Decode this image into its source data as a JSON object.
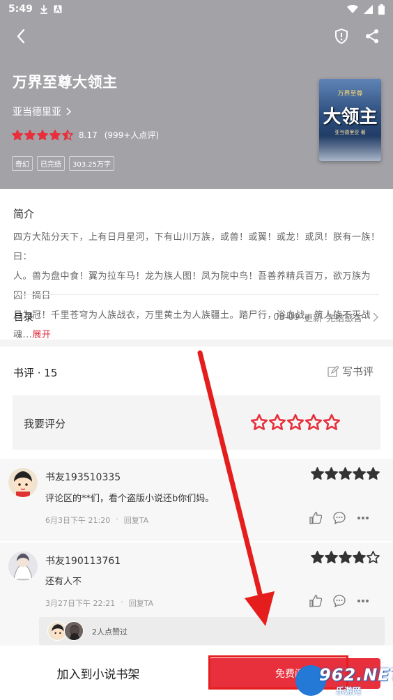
{
  "status_bar": {
    "time": "5:49"
  },
  "book": {
    "title": "万界至尊大领主",
    "author": "亚当德里亚",
    "score": "8.17",
    "rating_count": "(999+人点评)",
    "stars_filled": 4.5,
    "tags": [
      "奇幻",
      "已完结",
      "303.25万字"
    ],
    "cover": {
      "line1": "万界至尊",
      "line2": "大领主",
      "line3": "亚当德里亚 著"
    }
  },
  "intro": {
    "title": "简介",
    "lines": [
      "四方大陆分天下，上有日月星河，下有山川万族，或兽！或翼！或龙！或凤！朕有一族！曰：",
      "人。兽为盘中食！翼为拉车马！龙为族人图！凤为院中鸟！吾善养精兵百万，欲万族为囚！摘日",
      "月为冠！千里苍穹为人族战衣，万里黄土为人族疆土。踏尸行，浴血战，筑人族不灭战魂..."
    ],
    "expand": "展开"
  },
  "toc": {
    "label": "目录",
    "date": "03-09",
    "update": "更新",
    "latest": "完结感言"
  },
  "reviews": {
    "title": "书评 · 15",
    "write": "写书评",
    "rate_prompt": "我要评分",
    "items": [
      {
        "user": "书友193510335",
        "stars": 5,
        "text": "评论区的**们，看个盗版小说还b你们妈。",
        "time": "6月3日下午 21:20",
        "reply": "回复TA"
      },
      {
        "user": "书友190113761",
        "stars": 4,
        "text": "还有人不",
        "time": "3月27日下午 22:21",
        "dot": "·",
        "reply": "回复TA",
        "liked_by": "2人点赞过"
      }
    ]
  },
  "bottom": {
    "add_shelf": "加入到小说书架",
    "free_read": "免费阅读"
  },
  "watermark": {
    "number": "962.NET",
    "sub": "乐游网"
  },
  "colors": {
    "accent": "#e8303d",
    "header_bg": "#a3a2a7",
    "star_dark": "#333333"
  }
}
